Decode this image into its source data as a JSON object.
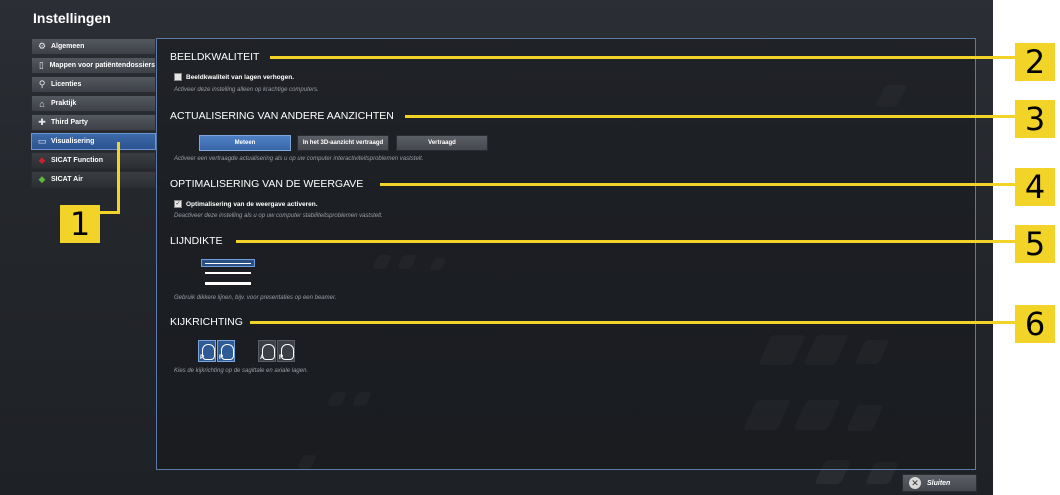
{
  "window": {
    "title": "Instellingen"
  },
  "sidebar": {
    "items": [
      {
        "label": "Algemeen",
        "icon": "gears-icon"
      },
      {
        "label": "Mappen voor patiëntendossiers",
        "icon": "folder-icon"
      },
      {
        "label": "Licenties",
        "icon": "key-icon"
      },
      {
        "label": "Praktijk",
        "icon": "house-icon"
      },
      {
        "label": "Third Party",
        "icon": "puzzle-icon"
      },
      {
        "label": "Visualisering",
        "icon": "monitor-icon",
        "active": true
      },
      {
        "label": "SICAT Function",
        "icon": "sicat-function-icon"
      },
      {
        "label": "SICAT Air",
        "icon": "sicat-air-icon"
      }
    ]
  },
  "sections": {
    "image_quality": {
      "title": "BEELDKWALITEIT",
      "checkbox_label": "Beeldkwaliteit van lagen verhogen.",
      "checked": false,
      "hint": "Activeer deze instelling alleen op krachtige computers."
    },
    "other_views": {
      "title": "ACTUALISERING VAN ANDERE AANZICHTEN",
      "buttons": [
        "Meteen",
        "In het 3D-aanzicht vertraagd",
        "Vertraagd"
      ],
      "selected": "Meteen",
      "hint": "Activeer een vertraagde actualisering als u op uw computer interactiviteitsproblemen vaststelt."
    },
    "display_optimization": {
      "title": "OPTIMALISERING VAN DE WEERGAVE",
      "checkbox_label": "Optimalisering van de weergave activeren.",
      "checked": true,
      "hint": "Deactiveer deze instelling als u op uw computer stabiliteitsproblemen vaststelt."
    },
    "line_thickness": {
      "title": "LIJNDIKTE",
      "options": [
        "thin",
        "medium",
        "thick"
      ],
      "selected": "thin",
      "hint": "Gebruik dikkere lijnen, bijv. voor presentaties op een beamer."
    },
    "viewing_direction": {
      "title": "KIJKRICHTING",
      "sagittal_letters": [
        "P",
        "R"
      ],
      "axial_letters": [
        "A",
        "R"
      ],
      "hint": "Kies de kijkrichting op de sagittale en axiale lagen."
    }
  },
  "footer": {
    "close_label": "Sluiten"
  },
  "callouts": [
    "1",
    "2",
    "3",
    "4",
    "5",
    "6"
  ],
  "colors": {
    "callout": "#f2d327",
    "accent": "#3866a8",
    "background": "#24272c"
  }
}
